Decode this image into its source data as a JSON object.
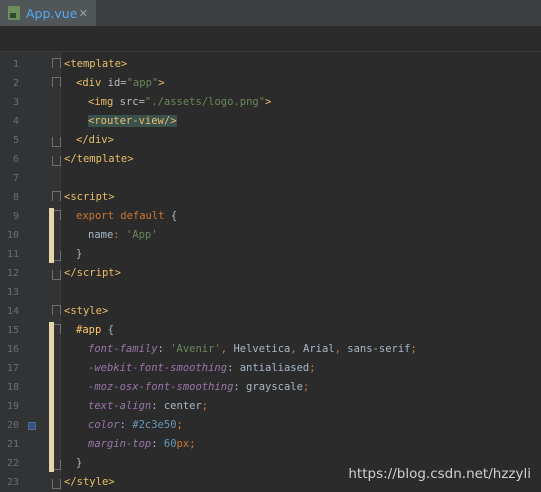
{
  "tab": {
    "label": "App.vue",
    "close": "✕"
  },
  "watermark": "https://blog.csdn.net/hzzyli",
  "lines": [
    {
      "n": "1",
      "fold": "open",
      "segs": [
        [
          "t-br",
          "<"
        ],
        [
          "t-tag",
          "template"
        ],
        [
          "t-br",
          ">"
        ]
      ]
    },
    {
      "n": "2",
      "fold": "open",
      "indent": 1,
      "segs": [
        [
          "t-br",
          "<"
        ],
        [
          "t-tag",
          "div "
        ],
        [
          "t-attr",
          "id"
        ],
        [
          "t-plain",
          "="
        ],
        [
          "t-str",
          "\"app\""
        ],
        [
          "t-br",
          ">"
        ]
      ]
    },
    {
      "n": "3",
      "indent": 2,
      "segs": [
        [
          "t-br",
          "<"
        ],
        [
          "t-tag",
          "img "
        ],
        [
          "t-attr",
          "src"
        ],
        [
          "t-plain",
          "="
        ],
        [
          "t-str",
          "\"./assets/logo.png\""
        ],
        [
          "t-br",
          ">"
        ]
      ]
    },
    {
      "n": "4",
      "indent": 2,
      "hl": true,
      "segs": [
        [
          "t-br",
          "<"
        ],
        [
          "t-tag",
          "router-view"
        ],
        [
          "t-br",
          "/>"
        ]
      ]
    },
    {
      "n": "5",
      "fold": "close",
      "indent": 1,
      "segs": [
        [
          "t-br",
          "</"
        ],
        [
          "t-tag",
          "div"
        ],
        [
          "t-br",
          ">"
        ]
      ]
    },
    {
      "n": "6",
      "fold": "close",
      "segs": [
        [
          "t-br",
          "</"
        ],
        [
          "t-tag",
          "template"
        ],
        [
          "t-br",
          ">"
        ]
      ]
    },
    {
      "n": "7",
      "segs": []
    },
    {
      "n": "8",
      "fold": "open",
      "segs": [
        [
          "t-br",
          "<"
        ],
        [
          "t-tag",
          "script"
        ],
        [
          "t-br",
          ">"
        ]
      ]
    },
    {
      "n": "9",
      "fold": "open",
      "indent": 1,
      "segs": [
        [
          "t-kw",
          "export default "
        ],
        [
          "t-plain",
          "{"
        ]
      ]
    },
    {
      "n": "10",
      "indent": 2,
      "segs": [
        [
          "t-plain",
          "name"
        ],
        [
          "t-kw",
          ": "
        ],
        [
          "t-str",
          "'App'"
        ]
      ]
    },
    {
      "n": "11",
      "fold": "close",
      "indent": 1,
      "segs": [
        [
          "t-plain",
          "}"
        ]
      ]
    },
    {
      "n": "12",
      "fold": "close",
      "segs": [
        [
          "t-br",
          "</"
        ],
        [
          "t-tag",
          "script"
        ],
        [
          "t-br",
          ">"
        ]
      ]
    },
    {
      "n": "13",
      "segs": []
    },
    {
      "n": "14",
      "fold": "open",
      "segs": [
        [
          "t-br",
          "<"
        ],
        [
          "t-tag",
          "style"
        ],
        [
          "t-br",
          ">"
        ]
      ]
    },
    {
      "n": "15",
      "fold": "open",
      "indent": 1,
      "segs": [
        [
          "t-sel",
          "#app "
        ],
        [
          "t-plain",
          "{"
        ]
      ]
    },
    {
      "n": "16",
      "indent": 2,
      "segs": [
        [
          "t-prop",
          "font-family"
        ],
        [
          "t-plain",
          ": "
        ],
        [
          "t-str",
          "'Avenir'"
        ],
        [
          "t-kw",
          ", "
        ],
        [
          "t-plain",
          "Helvetica"
        ],
        [
          "t-kw",
          ", "
        ],
        [
          "t-plain",
          "Arial"
        ],
        [
          "t-kw",
          ", "
        ],
        [
          "t-plain",
          "sans-serif"
        ],
        [
          "t-kw",
          ";"
        ]
      ]
    },
    {
      "n": "17",
      "indent": 2,
      "segs": [
        [
          "t-prop",
          "-webkit-font-smoothing"
        ],
        [
          "t-plain",
          ": antialiased"
        ],
        [
          "t-kw",
          ";"
        ]
      ]
    },
    {
      "n": "18",
      "indent": 2,
      "segs": [
        [
          "t-prop",
          "-moz-osx-font-smoothing"
        ],
        [
          "t-plain",
          ": grayscale"
        ],
        [
          "t-kw",
          ";"
        ]
      ]
    },
    {
      "n": "19",
      "indent": 2,
      "segs": [
        [
          "t-prop",
          "text-align"
        ],
        [
          "t-plain",
          ": center"
        ],
        [
          "t-kw",
          ";"
        ]
      ]
    },
    {
      "n": "20",
      "indent": 2,
      "marker": true,
      "segs": [
        [
          "t-prop",
          "color"
        ],
        [
          "t-plain",
          ": "
        ],
        [
          "t-num",
          "#2c3e50"
        ],
        [
          "t-kw",
          ";"
        ]
      ]
    },
    {
      "n": "21",
      "indent": 2,
      "segs": [
        [
          "t-prop",
          "margin-top"
        ],
        [
          "t-plain",
          ": "
        ],
        [
          "t-num",
          "60"
        ],
        [
          "t-kw",
          "px"
        ],
        [
          "t-kw",
          ";"
        ]
      ]
    },
    {
      "n": "22",
      "fold": "close",
      "indent": 1,
      "segs": [
        [
          "t-plain",
          "}"
        ]
      ]
    },
    {
      "n": "23",
      "fold": "close",
      "segs": [
        [
          "t-br",
          "</"
        ],
        [
          "t-tag",
          "style"
        ],
        [
          "t-br",
          ">"
        ]
      ]
    }
  ]
}
